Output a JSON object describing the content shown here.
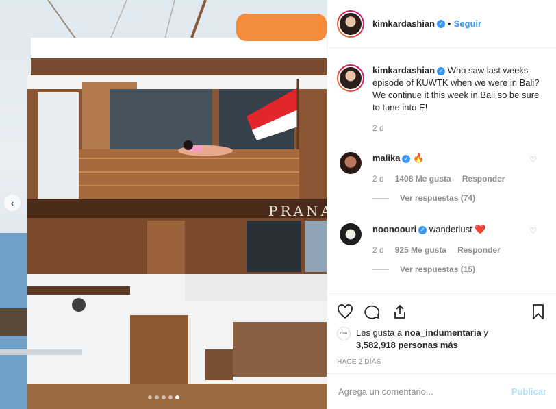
{
  "post": {
    "author": "kimkardashian",
    "follow_label": "Seguir",
    "separator": "•",
    "caption": "Who saw last weeks episode of KUWTK when we were in Bali? We continue it this week in Bali so be sure to tune into E!",
    "caption_time": "2 d",
    "boat_name": "PRANA",
    "carousel_count": 5,
    "carousel_active": 5
  },
  "comments": [
    {
      "user": "malika",
      "text": "🔥",
      "time": "2 d",
      "likes": "1408 Me gusta",
      "reply_label": "Responder",
      "view_replies": "Ver respuestas (74)"
    },
    {
      "user": "noonoouri",
      "text": "wanderlust ❤️",
      "time": "2 d",
      "likes": "925 Me gusta",
      "reply_label": "Responder",
      "view_replies": "Ver respuestas (15)"
    }
  ],
  "likes_summary": {
    "line1_prefix": "Les gusta a ",
    "user": "noa_indumentaria",
    "line1_suffix": " y",
    "line2": "3,582,918 personas más",
    "avatar_text": "noa"
  },
  "timestamp": "HACE 2 DÍAS",
  "composer": {
    "placeholder": "Agrega un comentario...",
    "publish_label": "Publicar"
  },
  "icons": {
    "like": "heart-icon",
    "comment": "comment-icon",
    "share": "share-icon",
    "save": "bookmark-icon",
    "verified": "verified-badge-icon",
    "prev": "chevron-left-icon"
  },
  "colors": {
    "accent": "#3897f0",
    "publish_disabled": "#b2dffc",
    "muted": "#8e8e8e"
  }
}
